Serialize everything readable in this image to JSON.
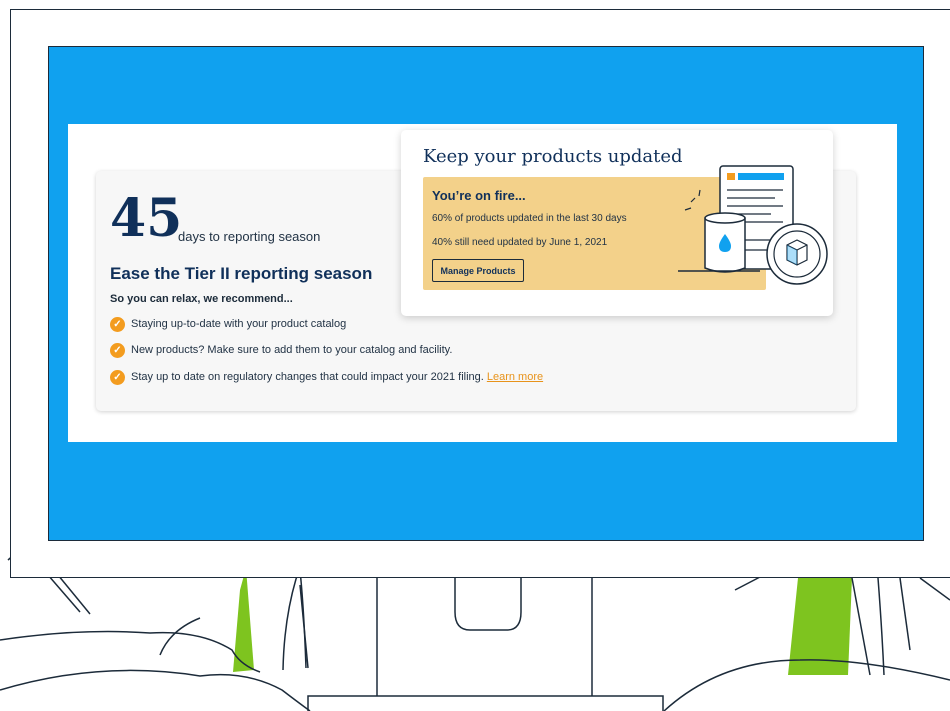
{
  "reporting": {
    "days_count": "45",
    "days_label": "days to reporting season",
    "heading": "Ease the Tier II reporting season",
    "subheading": "So you can relax, we recommend...",
    "items": [
      {
        "text": "Staying up-to-date with your product catalog"
      },
      {
        "text": "New products? Make sure to add them to your catalog and facility."
      },
      {
        "text": "Stay up to date on regulatory changes that could impact your 2021 filing.",
        "link": "Learn more"
      }
    ]
  },
  "products_card": {
    "title": "Keep your products updated",
    "status_title": "You’re on fire...",
    "line1": "60% of products updated in the last 30 days",
    "line2": "40% still need updated by June 1, 2021",
    "button_label": "Manage Products"
  },
  "colors": {
    "screen_blue": "#10a1ef",
    "accent_orange": "#f39c1f",
    "card_yellow": "#f3d18a",
    "navy": "#10305a",
    "plant_green": "#7ec41f"
  },
  "icons": [
    "check-circle-icon",
    "document-icon",
    "barrel-icon",
    "water-drop-icon",
    "box-refresh-icon"
  ]
}
